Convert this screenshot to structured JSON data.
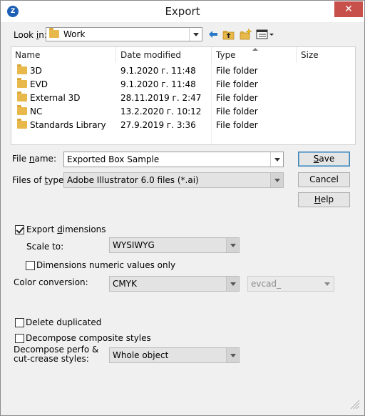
{
  "window": {
    "title": "Export",
    "app_icon_glyph": "Z",
    "close_glyph": "✕"
  },
  "look_in": {
    "label_pre": "Look ",
    "label_key": "i",
    "label_post": "n:",
    "value": "Work",
    "toolbar_icons": [
      "back-arrow-icon",
      "up-folder-icon",
      "new-folder-icon",
      "view-menu-icon"
    ]
  },
  "file_list": {
    "columns": [
      "Name",
      "Date modified",
      "Type",
      "Size"
    ],
    "rows": [
      {
        "name": "3D",
        "date": "9.1.2020 г. 11:48",
        "type": "File folder",
        "size": ""
      },
      {
        "name": "EVD",
        "date": "9.1.2020 г. 11:48",
        "type": "File folder",
        "size": ""
      },
      {
        "name": "External 3D",
        "date": "28.11.2019 г. 2:47",
        "type": "File folder",
        "size": ""
      },
      {
        "name": "NC",
        "date": "13.2.2020 г. 10:12",
        "type": "File folder",
        "size": ""
      },
      {
        "name": "Standards Library",
        "date": "27.9.2019 г. 3:36",
        "type": "File folder",
        "size": ""
      }
    ]
  },
  "file_name": {
    "label_pre": "File ",
    "label_key": "n",
    "label_post": "ame:",
    "value": "Exported Box Sample"
  },
  "file_type": {
    "label_pre": "Files of ",
    "label_key": "t",
    "label_post": "ype:",
    "value": "Adobe Illustrator 6.0 files (*.ai)"
  },
  "buttons": {
    "save_key": "S",
    "save_rest": "ave",
    "cancel": "Cancel",
    "help_key": "H",
    "help_rest": "elp"
  },
  "options": {
    "export_dimensions_pre": "Export ",
    "export_dimensions_key": "d",
    "export_dimensions_post": "imensions",
    "export_dimensions_checked": true,
    "scale_to_label": "Scale to:",
    "scale_to_value": "WYSIWYG",
    "dimensions_numeric": "Dimensions numeric values only",
    "dimensions_numeric_checked": false,
    "color_conversion_label": "Color conversion:",
    "color_conversion_value": "CMYK",
    "color_profile_value": "evcad_",
    "delete_duplicated": "Delete duplicated",
    "delete_duplicated_checked": false,
    "decompose_composite": "Decompose composite styles",
    "decompose_composite_checked": false,
    "decompose_perfo_line1": "Decompose perfo &",
    "decompose_perfo_line2": "cut-crease styles:",
    "decompose_perfo_value": "Whole object"
  }
}
